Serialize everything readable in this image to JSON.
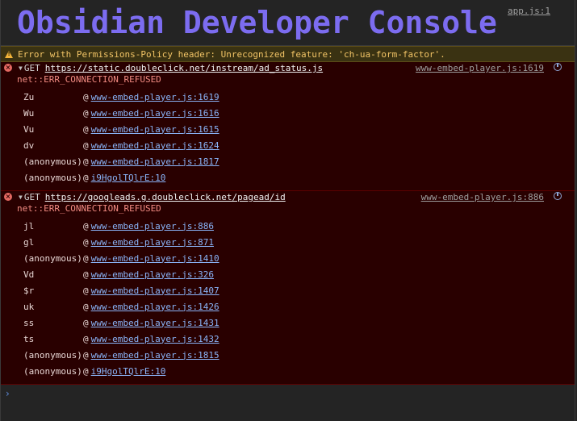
{
  "header": {
    "title": "Obsidian Developer Console",
    "source": "app.js:1",
    "title_color": "#7c6cf0"
  },
  "warning": {
    "text": "Error with Permissions-Policy header: Unrecognized feature: 'ch-ua-form-factor'.",
    "icon": "warning-triangle-icon"
  },
  "errors": [
    {
      "method": "GET",
      "url": "https://static.doubleclick.net/instream/ad_status.js",
      "source": "www-embed-player.js:1619",
      "message": "net::ERR_CONNECTION_REFUSED",
      "stack": [
        {
          "fn": "Zu",
          "at": "@",
          "link": "www-embed-player.js:1619"
        },
        {
          "fn": "Wu",
          "at": "@",
          "link": "www-embed-player.js:1616"
        },
        {
          "fn": "Vu",
          "at": "@",
          "link": "www-embed-player.js:1615"
        },
        {
          "fn": "dv",
          "at": "@",
          "link": "www-embed-player.js:1624"
        },
        {
          "fn": "(anonymous)",
          "at": "@",
          "link": "www-embed-player.js:1817"
        },
        {
          "fn": "(anonymous)",
          "at": "@",
          "link": "i9HgolTQlrE:10"
        }
      ]
    },
    {
      "method": "GET",
      "url": "https://googleads.g.doubleclick.net/pagead/id",
      "source": "www-embed-player.js:886",
      "message": "net::ERR_CONNECTION_REFUSED",
      "stack": [
        {
          "fn": "jl",
          "at": "@",
          "link": "www-embed-player.js:886"
        },
        {
          "fn": "gl",
          "at": "@",
          "link": "www-embed-player.js:871"
        },
        {
          "fn": "(anonymous)",
          "at": "@",
          "link": "www-embed-player.js:1410"
        },
        {
          "fn": "Vd",
          "at": "@",
          "link": "www-embed-player.js:326"
        },
        {
          "fn": "$r",
          "at": "@",
          "link": "www-embed-player.js:1407"
        },
        {
          "fn": "uk",
          "at": "@",
          "link": "www-embed-player.js:1426"
        },
        {
          "fn": "ss",
          "at": "@",
          "link": "www-embed-player.js:1431"
        },
        {
          "fn": "ts",
          "at": "@",
          "link": "www-embed-player.js:1432"
        },
        {
          "fn": "(anonymous)",
          "at": "@",
          "link": "www-embed-player.js:1815"
        },
        {
          "fn": "(anonymous)",
          "at": "@",
          "link": "i9HgolTQlrE:10"
        }
      ]
    }
  ],
  "prompt": {
    "caret": "›",
    "value": ""
  }
}
